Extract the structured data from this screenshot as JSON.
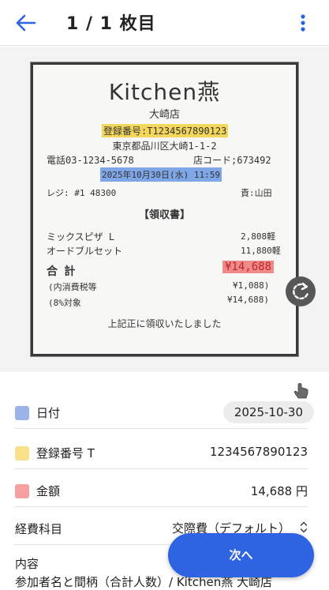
{
  "header": {
    "title": "1 / 1 枚目",
    "back_icon": "arrow-back-icon",
    "menu_icon": "more-vert-icon"
  },
  "receipt": {
    "shop_name": "Kitchen燕",
    "branch": "大崎店",
    "registration": "登録番号:T1234567890123",
    "address": "東京都品川区大崎1-1-2",
    "tel": "電話03-1234-5678",
    "store_code": "店コード;673492",
    "datetime": "2025年10月30日(水) 11:59",
    "register": "レジ: #1 48300",
    "staff": "責:山田",
    "heading": "【領収書】",
    "items": [
      {
        "name": "ミックスピザ L",
        "price": "2,808軽"
      },
      {
        "name": "オードブルセット",
        "price": "11,880軽"
      }
    ],
    "total_label": "合 計",
    "total_value": "¥14,688",
    "tax_label": "(内消費税等",
    "tax_value": "¥1,088)",
    "rate_label": "(8%対象",
    "rate_value": "¥14,688)",
    "footer": "上記正に領収いたしました"
  },
  "fields": {
    "date": {
      "label": "日付",
      "value": "2025-10-30",
      "color": "#9cb3e8"
    },
    "registration": {
      "label": "登録番号 T",
      "value": "1234567890123",
      "color": "#f9e08a"
    },
    "amount": {
      "label": "金額",
      "value": "14,688 円",
      "color": "#f6a0a0"
    },
    "account": {
      "label": "経費科目",
      "value": "交際費（デフォルト）"
    },
    "content": {
      "label": "内容",
      "value": "参加者名と間柄（合計人数）/ Kitchen燕 大崎店"
    }
  },
  "actions": {
    "next_label": "次へ",
    "rotate_icon": "rotate-icon",
    "hand_icon": "hand-pointer-icon"
  },
  "colors": {
    "accent": "#2e63e2",
    "highlight_yellow": "#f4d75a",
    "highlight_blue": "#7fa6e6",
    "highlight_red": "#ee8a8a"
  }
}
